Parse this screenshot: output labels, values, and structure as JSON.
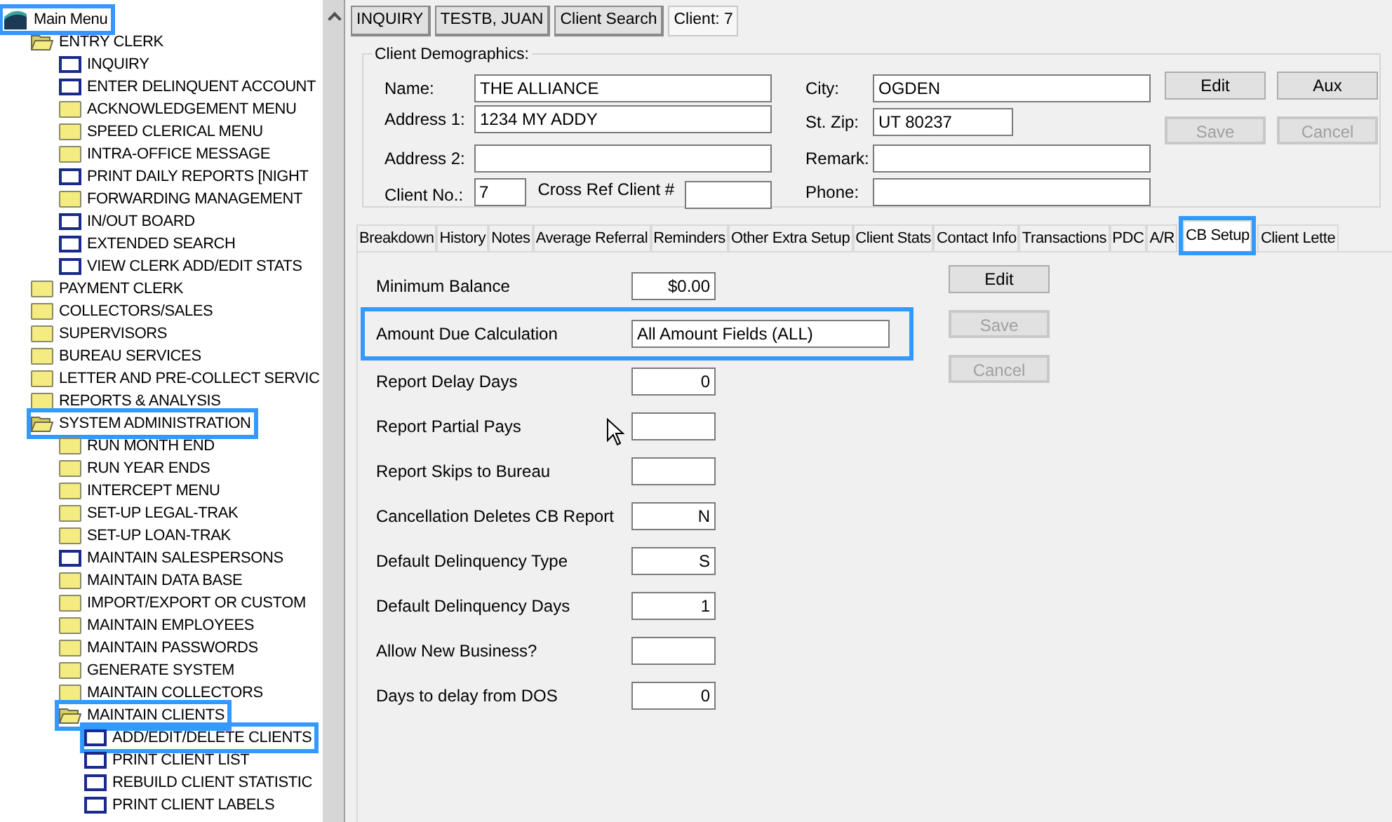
{
  "tree": {
    "label": "Main Menu",
    "kind": "app",
    "highlighted": true,
    "children": [
      {
        "label": "ENTRY CLERK",
        "kind": "folder",
        "expanded": true,
        "highlighted": false,
        "children": [
          {
            "label": "INQUIRY",
            "kind": "form"
          },
          {
            "label": "ENTER DELINQUENT ACCOUNT",
            "kind": "form"
          },
          {
            "label": "ACKNOWLEDGEMENT MENU",
            "kind": "folder"
          },
          {
            "label": "SPEED CLERICAL MENU",
            "kind": "folder"
          },
          {
            "label": "INTRA-OFFICE MESSAGE",
            "kind": "folder"
          },
          {
            "label": "PRINT DAILY REPORTS   [NIGHT",
            "kind": "form"
          },
          {
            "label": "FORWARDING MANAGEMENT",
            "kind": "folder"
          },
          {
            "label": "IN/OUT BOARD",
            "kind": "form"
          },
          {
            "label": "EXTENDED SEARCH",
            "kind": "form"
          },
          {
            "label": "VIEW CLERK ADD/EDIT STATS",
            "kind": "form"
          }
        ]
      },
      {
        "label": "PAYMENT CLERK",
        "kind": "folder"
      },
      {
        "label": "COLLECTORS/SALES",
        "kind": "folder"
      },
      {
        "label": "SUPERVISORS",
        "kind": "folder"
      },
      {
        "label": "BUREAU SERVICES",
        "kind": "folder"
      },
      {
        "label": "LETTER AND PRE-COLLECT SERVIC",
        "kind": "folder"
      },
      {
        "label": "REPORTS & ANALYSIS",
        "kind": "folder"
      },
      {
        "label": "SYSTEM ADMINISTRATION",
        "kind": "folder",
        "expanded": true,
        "highlighted": true,
        "children": [
          {
            "label": "RUN MONTH END",
            "kind": "folder"
          },
          {
            "label": "RUN YEAR ENDS",
            "kind": "folder"
          },
          {
            "label": "INTERCEPT MENU",
            "kind": "folder"
          },
          {
            "label": "SET-UP LEGAL-TRAK",
            "kind": "folder"
          },
          {
            "label": "SET-UP LOAN-TRAK",
            "kind": "folder"
          },
          {
            "label": "MAINTAIN SALESPERSONS",
            "kind": "form"
          },
          {
            "label": "MAINTAIN DATA BASE",
            "kind": "folder"
          },
          {
            "label": "IMPORT/EXPORT OR CUSTOM",
            "kind": "folder"
          },
          {
            "label": "MAINTAIN EMPLOYEES",
            "kind": "folder"
          },
          {
            "label": "MAINTAIN PASSWORDS",
            "kind": "folder"
          },
          {
            "label": "GENERATE SYSTEM",
            "kind": "folder"
          },
          {
            "label": "MAINTAIN COLLECTORS",
            "kind": "folder"
          },
          {
            "label": "MAINTAIN CLIENTS",
            "kind": "folder",
            "expanded": true,
            "highlighted": true,
            "children": [
              {
                "label": "ADD/EDIT/DELETE CLIENTS",
                "kind": "form",
                "highlighted": true
              },
              {
                "label": "PRINT CLIENT LIST",
                "kind": "form"
              },
              {
                "label": "REBUILD CLIENT STATISTIC",
                "kind": "form"
              },
              {
                "label": "PRINT CLIENT LABELS",
                "kind": "form"
              }
            ]
          }
        ]
      }
    ]
  },
  "header_buttons": [
    {
      "label": "INQUIRY",
      "selected": false
    },
    {
      "label": "TESTB, JUAN",
      "selected": false
    },
    {
      "label": "Client Search",
      "selected": false
    },
    {
      "label": "Client: 7",
      "selected": true
    }
  ],
  "demographics": {
    "title": "Client Demographics:",
    "name": {
      "label": "Name:",
      "value": "THE ALLIANCE"
    },
    "address1": {
      "label": "Address 1:",
      "value": "1234 MY ADDY"
    },
    "address2": {
      "label": "Address 2:"
    },
    "client_no": {
      "label": "Client No.:",
      "value": "7"
    },
    "cross_ref": {
      "label": "Cross Ref Client #"
    },
    "city": {
      "label": "City:",
      "value": "OGDEN"
    },
    "st_zip": {
      "label": "St. Zip:",
      "value": "UT 80237"
    },
    "remark": {
      "label": "Remark:"
    },
    "phone": {
      "label": "Phone:"
    },
    "buttons": [
      {
        "label": "Edit",
        "disabled": false
      },
      {
        "label": "Aux",
        "disabled": false
      },
      {
        "label": "Save",
        "disabled": true
      },
      {
        "label": "Cancel",
        "disabled": true
      }
    ]
  },
  "tabs": [
    {
      "label": "Breakdown",
      "selected": false,
      "highlighted": false
    },
    {
      "label": "History",
      "selected": false,
      "highlighted": false
    },
    {
      "label": "Notes",
      "selected": false,
      "highlighted": false
    },
    {
      "label": "Average Referral",
      "selected": false,
      "highlighted": false
    },
    {
      "label": "Reminders",
      "selected": false,
      "highlighted": false
    },
    {
      "label": "Other Extra Setup",
      "selected": false,
      "highlighted": false
    },
    {
      "label": "Client Stats",
      "selected": false,
      "highlighted": false
    },
    {
      "label": "Contact Info",
      "selected": false,
      "highlighted": false
    },
    {
      "label": "Transactions",
      "selected": false,
      "highlighted": false
    },
    {
      "label": "PDC",
      "selected": false,
      "highlighted": false
    },
    {
      "label": "A/R",
      "selected": false,
      "highlighted": false
    },
    {
      "label": "CB Setup",
      "selected": true,
      "highlighted": true
    },
    {
      "label": "Client Lette",
      "selected": false,
      "highlighted": false
    }
  ],
  "cb_setup": {
    "fields": [
      {
        "label": "Minimum Balance",
        "value": "$0.00",
        "wide": false,
        "highlighted": false
      },
      {
        "label": "Amount Due Calculation",
        "value": "All Amount Fields (ALL)",
        "wide": true,
        "highlighted": true
      },
      {
        "label": "Report Delay Days",
        "value": "0",
        "wide": false,
        "highlighted": false
      },
      {
        "label": "Report Partial Pays",
        "wide": false,
        "highlighted": false
      },
      {
        "label": "Report Skips to Bureau",
        "wide": false,
        "highlighted": false
      },
      {
        "label": "Cancellation Deletes CB Report",
        "value": "N",
        "wide": false,
        "highlighted": false
      },
      {
        "label": "Default Delinquency Type",
        "value": "S",
        "wide": false,
        "highlighted": false
      },
      {
        "label": "Default Delinquency Days",
        "value": "1",
        "wide": false,
        "highlighted": false
      },
      {
        "label": "Allow New Business?",
        "wide": false,
        "highlighted": false
      },
      {
        "label": "Days to delay from DOS",
        "value": "0",
        "wide": false,
        "highlighted": false
      }
    ],
    "buttons": [
      {
        "label": "Edit",
        "disabled": false
      },
      {
        "label": "Save",
        "disabled": true
      },
      {
        "label": "Cancel",
        "disabled": true
      }
    ]
  }
}
